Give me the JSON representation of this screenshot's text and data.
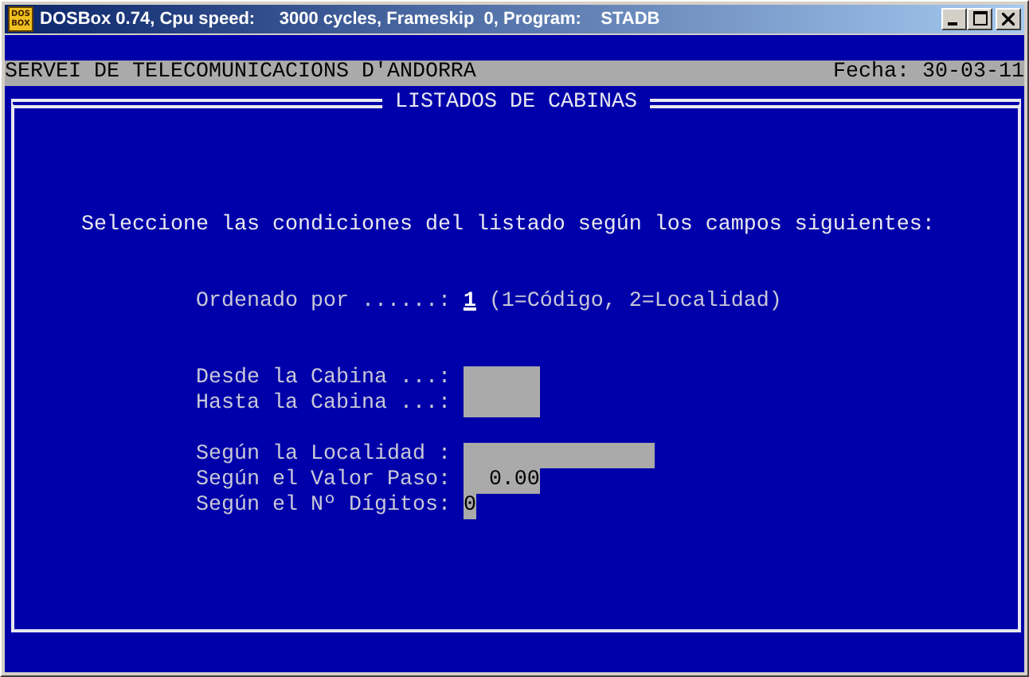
{
  "window": {
    "title": "DOSBox 0.74, Cpu speed:     3000 cycles, Frameskip  0, Program:    STADB",
    "icon_text": [
      "DOS",
      "BOX"
    ]
  },
  "header": {
    "left": "SERVEI DE TELECOMUNICACIONS D'ANDORRA",
    "right": "Fecha: 30-03-11"
  },
  "panel": {
    "title": "LISTADOS DE CABINAS",
    "instruction": "Seleccione las condiciones del listado según los campos siguientes:",
    "groups": [
      [
        {
          "kind": "choice",
          "label": "Ordenado por ......:",
          "value": "1",
          "cursor": true,
          "hint": "(1=Código, 2=Localidad)"
        }
      ],
      [
        {
          "kind": "code",
          "label": "Desde la Cabina ...:"
        },
        {
          "kind": "code",
          "label": "Hasta la Cabina ...:"
        }
      ],
      [
        {
          "kind": "locality",
          "label": "Según la Localidad :"
        },
        {
          "kind": "amount",
          "label": "Según el Valor Paso:",
          "value": "0.00"
        },
        {
          "kind": "digits",
          "label": "Según el Nº Dígitos:",
          "value": "0"
        }
      ]
    ]
  }
}
